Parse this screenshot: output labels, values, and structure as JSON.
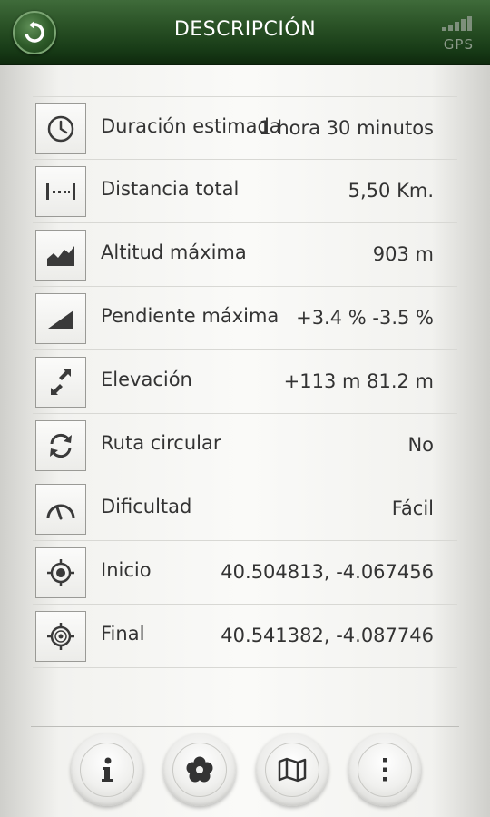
{
  "header": {
    "title": "DESCRIPCIÓN",
    "back_icon": "back-arrow-icon",
    "gps_label": "GPS"
  },
  "rows": [
    {
      "icon": "clock-icon",
      "label": "Duración estimada",
      "value": "1 hora 30 minutos"
    },
    {
      "icon": "distance-icon",
      "label": "Distancia total",
      "value": "5,50 Km."
    },
    {
      "icon": "altitude-icon",
      "label": "Altitud máxima",
      "value": "903 m"
    },
    {
      "icon": "slope-icon",
      "label": "Pendiente máxima",
      "value": "+3.4 % -3.5 %"
    },
    {
      "icon": "elevation-icon",
      "label": "Elevación",
      "value": "+113 m  81.2 m"
    },
    {
      "icon": "circular-route-icon",
      "label": "Ruta circular",
      "value": "No"
    },
    {
      "icon": "difficulty-icon",
      "label": "Dificultad",
      "value": "Fácil"
    },
    {
      "icon": "start-target-icon",
      "label": "Inicio",
      "value": "40.504813, -4.067456"
    },
    {
      "icon": "end-target-icon",
      "label": "Final",
      "value": "40.541382, -4.087746"
    }
  ],
  "toolbar": [
    {
      "icon": "info-icon"
    },
    {
      "icon": "flower-icon"
    },
    {
      "icon": "map-icon"
    },
    {
      "icon": "more-icon"
    }
  ],
  "colors": {
    "header_green": "#2a5226",
    "text": "#333333",
    "icon_dark": "#3a3a3a"
  }
}
